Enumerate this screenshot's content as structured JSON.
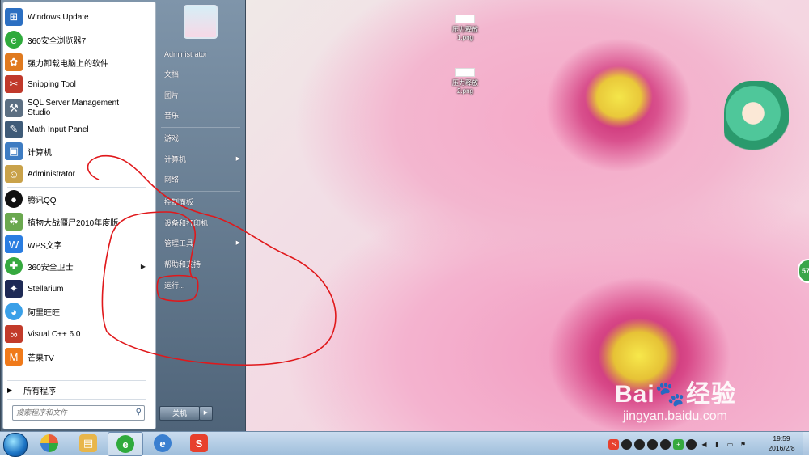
{
  "desktop": {
    "icons": [
      {
        "label": "压力释放1.png"
      },
      {
        "label": "压力释放2.png"
      }
    ],
    "side_badge": "57",
    "watermark": {
      "brand": "Bai🐾经验",
      "url": "jingyan.baidu.com"
    }
  },
  "start_menu": {
    "pinned": [
      {
        "label": "Windows Update",
        "icon": "windows-update-icon",
        "color": "#2b6fc2"
      },
      {
        "label": "360安全浏览器7",
        "icon": "browser-360-icon",
        "color": "#2faa3c"
      },
      {
        "label": "强力卸载电脑上的软件",
        "icon": "uninstall-icon",
        "color": "#e07a1f"
      },
      {
        "label": "Snipping Tool",
        "icon": "scissors-icon",
        "color": "#c0392b"
      },
      {
        "label": "SQL Server Management Studio",
        "icon": "tools-icon",
        "color": "#5c6f82"
      },
      {
        "label": "Math Input Panel",
        "icon": "math-icon",
        "color": "#3f5b78"
      },
      {
        "label": "计算机",
        "icon": "computer-icon",
        "color": "#3e7cc2"
      },
      {
        "label": "Administrator",
        "icon": "user-icon",
        "color": "#c9a24a"
      }
    ],
    "recent": [
      {
        "label": "腾讯QQ",
        "icon": "qq-icon",
        "color": "#111111"
      },
      {
        "label": "植物大战僵尸2010年度版",
        "icon": "game-icon",
        "color": "#6aa84f"
      },
      {
        "label": "WPS文字",
        "icon": "wps-icon",
        "color": "#2a7de1"
      },
      {
        "label": "360安全卫士",
        "icon": "guard-360-icon",
        "color": "#36a93f",
        "submenu": true
      },
      {
        "label": "Stellarium",
        "icon": "star-icon",
        "color": "#1e2a55"
      },
      {
        "label": "阿里旺旺",
        "icon": "wangwang-icon",
        "color": "#3aa0e8"
      },
      {
        "label": "Visual C++ 6.0",
        "icon": "vc-icon",
        "color": "#c23b2a"
      },
      {
        "label": "芒果TV",
        "icon": "mango-icon",
        "color": "#f07a1a"
      }
    ],
    "all_programs": "所有程序",
    "search_placeholder": "搜索程序和文件",
    "right": [
      {
        "label": "Administrator"
      },
      {
        "label": "文档"
      },
      {
        "label": "图片"
      },
      {
        "label": "音乐"
      },
      {
        "label": "游戏"
      },
      {
        "label": "计算机",
        "submenu": true
      },
      {
        "label": "网络"
      },
      {
        "label": "控制面板"
      },
      {
        "label": "设备和打印机"
      },
      {
        "label": "管理工具",
        "submenu": true
      },
      {
        "label": "帮助和支持"
      },
      {
        "label": "运行..."
      }
    ],
    "shutdown": "关机"
  },
  "taskbar": {
    "buttons": [
      {
        "icon": "pinwheel-icon",
        "color": "#e95c3b"
      },
      {
        "icon": "explorer-icon",
        "color": "#e8b64a"
      },
      {
        "icon": "browser-360-icon",
        "color": "#2faa3c",
        "active": true
      },
      {
        "icon": "ie-icon",
        "color": "#3a7fd0"
      },
      {
        "icon": "sogou-icon",
        "color": "#e7402d",
        "glyph": "S"
      }
    ],
    "tray": [
      "sogou-ime-icon",
      "qq-icon",
      "qq-icon",
      "qq-icon",
      "qq-icon",
      "guard-360-icon",
      "qq-icon",
      "volume-icon",
      "network-icon",
      "power-icon",
      "action-center-icon"
    ],
    "clock": {
      "time": "19:59",
      "date": "2016/2/8"
    }
  },
  "annotation_color": "#e0181b"
}
